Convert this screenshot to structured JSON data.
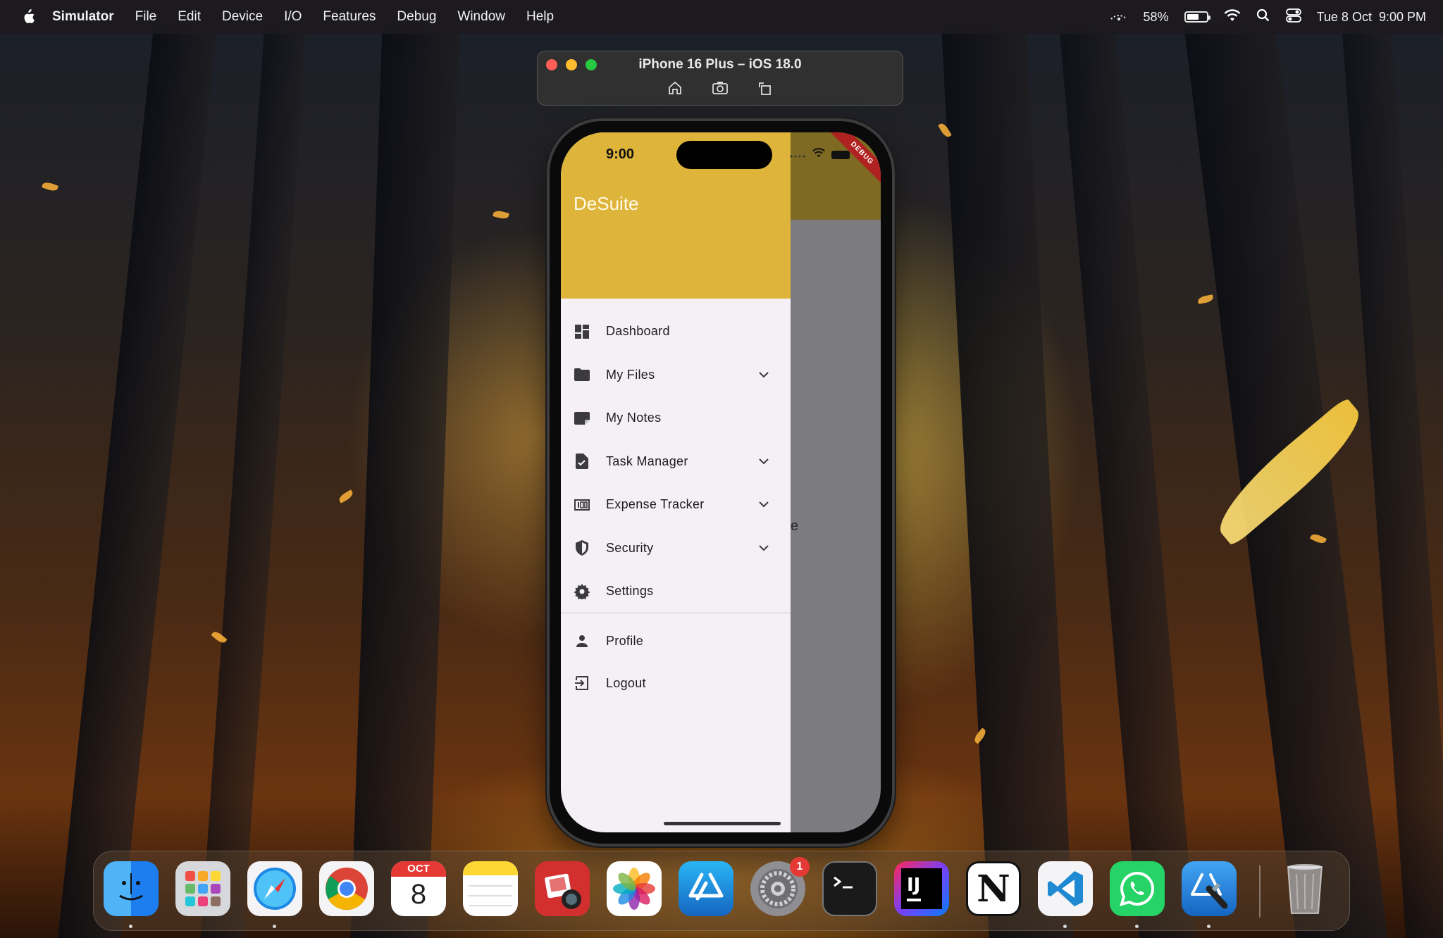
{
  "menubar": {
    "app_name": "Simulator",
    "items": [
      "File",
      "Edit",
      "Device",
      "I/O",
      "Features",
      "Debug",
      "Window",
      "Help"
    ],
    "battery_percent": "58%",
    "battery_level": 0.58,
    "date": "Tue 8 Oct",
    "time": "9:00 PM"
  },
  "simulator": {
    "title": "iPhone 16 Plus – iOS 18.0",
    "tools": [
      "home-icon",
      "screenshot-icon",
      "rotate-icon"
    ]
  },
  "phone": {
    "status_time": "9:00",
    "debug_banner": "DEBUG",
    "behind_text": "e"
  },
  "drawer": {
    "title": "DeSuite",
    "items": [
      {
        "label": "Dashboard",
        "icon": "dashboard-icon",
        "expandable": false
      },
      {
        "label": "My Files",
        "icon": "folder-icon",
        "expandable": true
      },
      {
        "label": "My Notes",
        "icon": "note-icon",
        "expandable": false
      },
      {
        "label": "Task Manager",
        "icon": "task-icon",
        "expandable": true
      },
      {
        "label": "Expense Tracker",
        "icon": "expense-icon",
        "expandable": true
      },
      {
        "label": "Security",
        "icon": "shield-icon",
        "expandable": true
      },
      {
        "label": "Settings",
        "icon": "gear-icon",
        "expandable": false
      }
    ],
    "bottom_items": [
      {
        "label": "Profile",
        "icon": "person-icon"
      },
      {
        "label": "Logout",
        "icon": "logout-icon"
      }
    ],
    "header_color": "#dfb43b"
  },
  "dock": {
    "apps": [
      {
        "name": "Finder",
        "icon": "finder-icon",
        "running": true
      },
      {
        "name": "Launchpad",
        "icon": "launchpad-icon",
        "running": false
      },
      {
        "name": "Safari",
        "icon": "safari-icon",
        "running": true
      },
      {
        "name": "Chrome",
        "icon": "chrome-icon",
        "running": false
      },
      {
        "name": "Calendar",
        "icon": "calendar-icon",
        "running": false,
        "month": "OCT",
        "day": "8"
      },
      {
        "name": "Notes",
        "icon": "notes-icon",
        "running": false
      },
      {
        "name": "Photo Booth",
        "icon": "photo-booth-icon",
        "running": false
      },
      {
        "name": "Photos",
        "icon": "photos-icon",
        "running": false
      },
      {
        "name": "App Store",
        "icon": "app-store-icon",
        "running": false
      },
      {
        "name": "System Settings",
        "icon": "system-settings-icon",
        "running": false,
        "badge": "1"
      },
      {
        "name": "Terminal",
        "icon": "terminal-icon",
        "running": false
      },
      {
        "name": "IntelliJ IDEA",
        "icon": "intellij-icon",
        "running": false,
        "text": "IJ"
      },
      {
        "name": "Notion",
        "icon": "notion-icon",
        "running": false,
        "text": "N"
      },
      {
        "name": "VS Code",
        "icon": "vscode-icon",
        "running": true
      },
      {
        "name": "WhatsApp",
        "icon": "whatsapp-icon",
        "running": true
      },
      {
        "name": "Xcode",
        "icon": "xcode-icon",
        "running": true
      }
    ],
    "trash": {
      "name": "Trash",
      "icon": "trash-icon"
    }
  }
}
